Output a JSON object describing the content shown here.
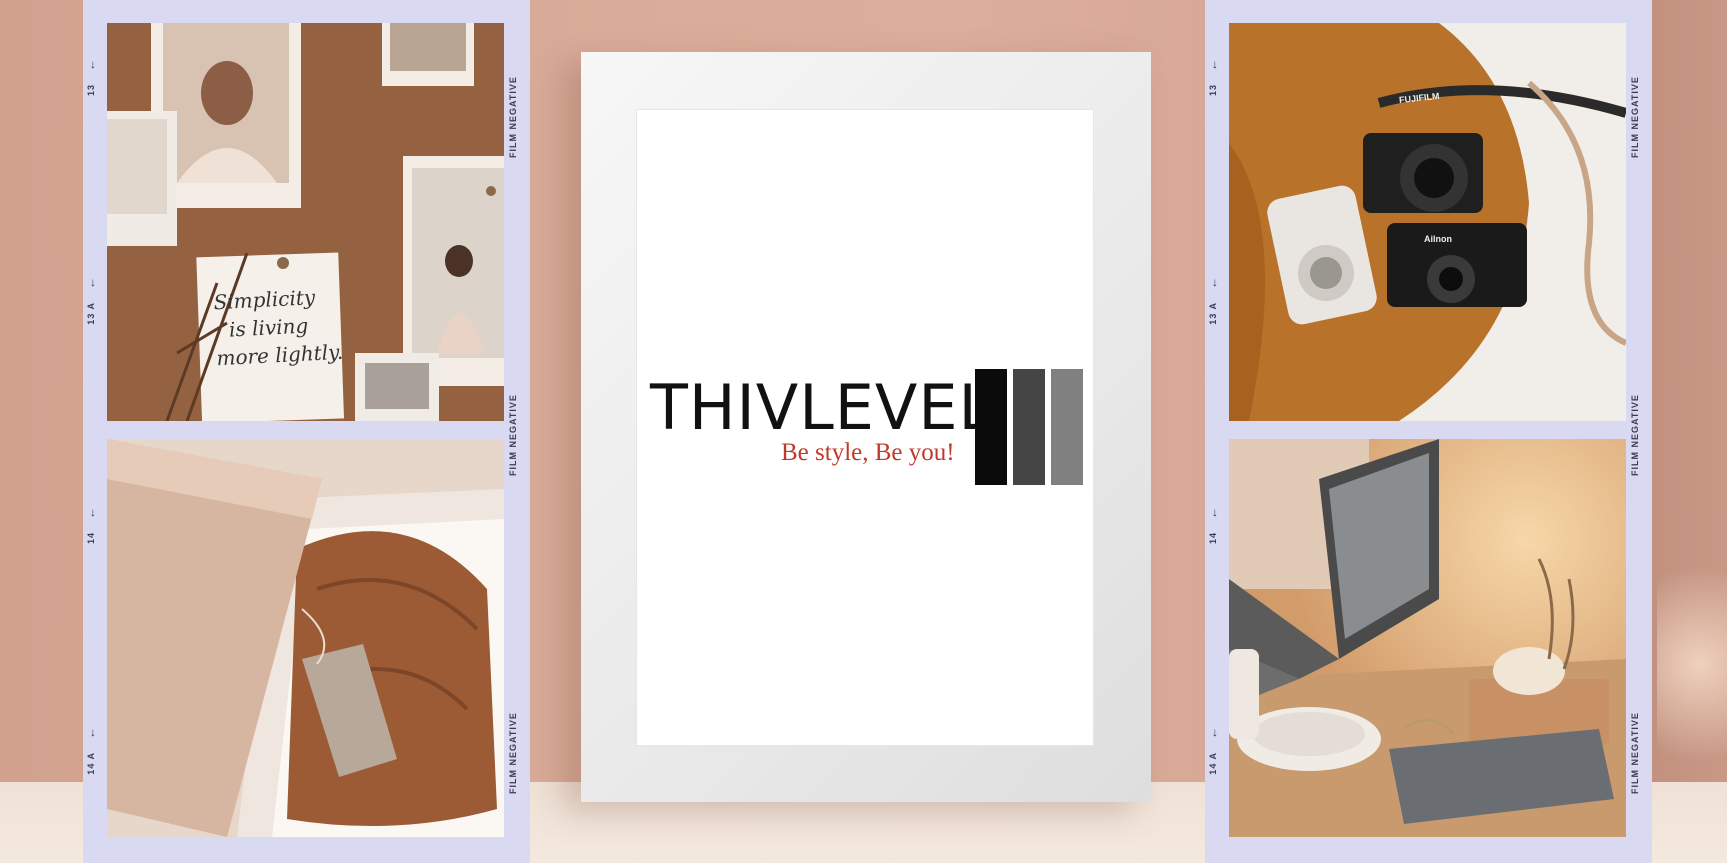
{
  "frame": {
    "brand": "THIVLEVEL",
    "tagline": "Be style, Be you!",
    "bars": [
      "#0b0b0b",
      "#454545",
      "#808080"
    ],
    "tagline_color": "#c0392b"
  },
  "left_strip": {
    "marks": [
      {
        "arrow": "→",
        "label": "13"
      },
      {
        "arrow": "→",
        "label": "13 A"
      },
      {
        "arrow": "→",
        "label": "14"
      },
      {
        "arrow": "→",
        "label": "14 A"
      }
    ],
    "side_text": [
      "FILM NEGATIVE",
      "FILM NEGATIVE",
      "FILM NEGATIVE"
    ],
    "note_lines": [
      "Simplicity",
      "is living",
      "more lightly."
    ]
  },
  "right_strip": {
    "marks": [
      {
        "arrow": "→",
        "label": "13"
      },
      {
        "arrow": "→",
        "label": "13 A"
      },
      {
        "arrow": "→",
        "label": "14"
      },
      {
        "arrow": "→",
        "label": "14 A"
      }
    ],
    "side_text": [
      "FILM NEGATIVE",
      "FILM NEGATIVE",
      "FILM NEGATIVE"
    ],
    "camera_labels": [
      "FUJIFILM",
      "Ailnon"
    ]
  }
}
